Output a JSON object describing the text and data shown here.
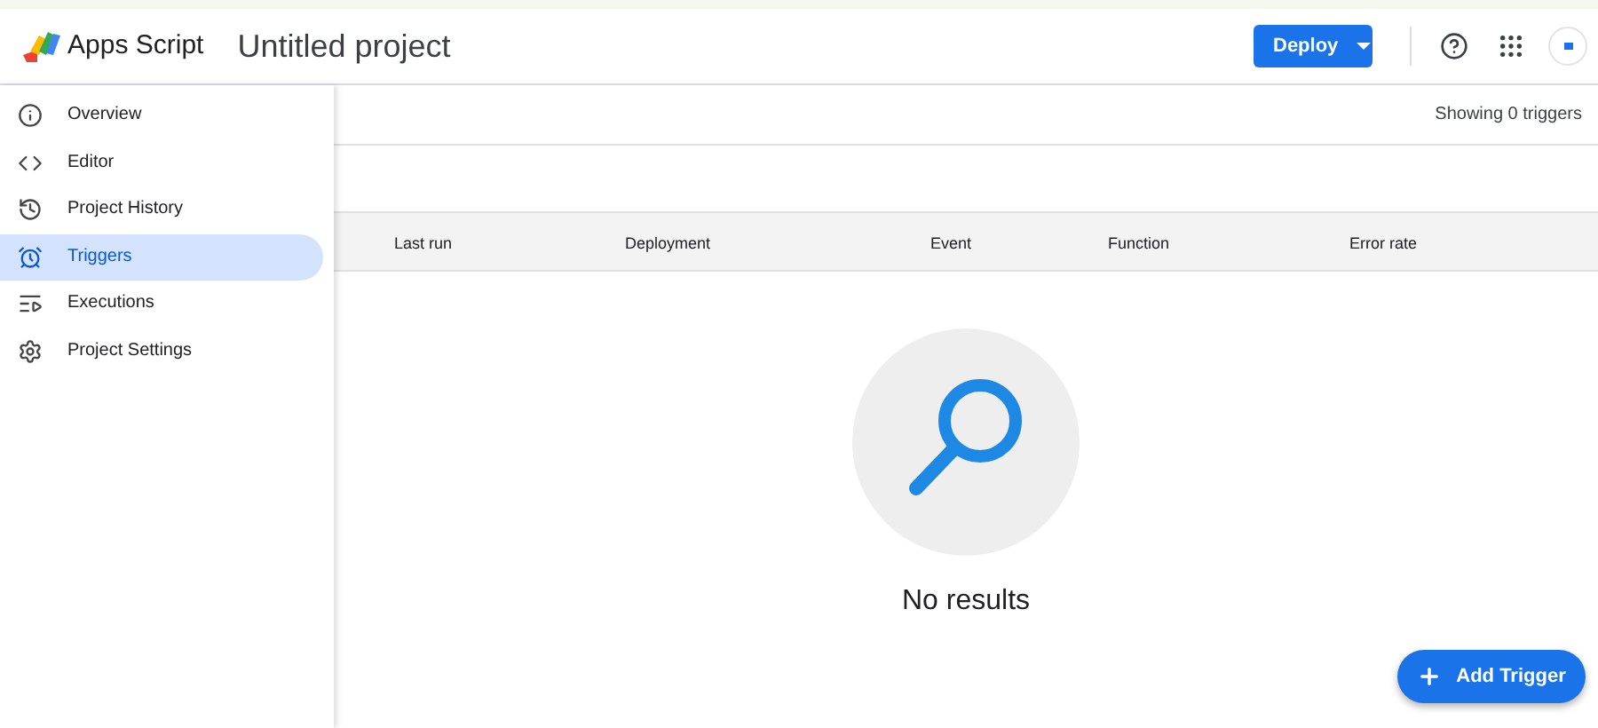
{
  "header": {
    "app_name": "Apps Script",
    "project_title": "Untitled project",
    "deploy_button": "Deploy"
  },
  "sidebar": {
    "items": [
      {
        "label": "Overview",
        "selected": false
      },
      {
        "label": "Editor",
        "selected": false
      },
      {
        "label": "Project History",
        "selected": false
      },
      {
        "label": "Triggers",
        "selected": true
      },
      {
        "label": "Executions",
        "selected": false
      },
      {
        "label": "Project Settings",
        "selected": false
      }
    ]
  },
  "summary": "Showing 0 triggers",
  "table": {
    "columns": [
      "Last run",
      "Deployment",
      "Event",
      "Function",
      "Error rate"
    ]
  },
  "empty_state": {
    "title": "No results"
  },
  "add_button": "Add Trigger"
}
